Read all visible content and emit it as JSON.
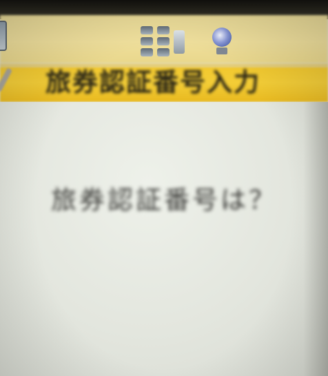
{
  "status_bar": {
    "icons": [
      "battery-icon",
      "grid-menu-icon",
      "globe-icon"
    ]
  },
  "header": {
    "title": "旅券認証番号入力",
    "back_icon": "back-icon"
  },
  "main": {
    "prompt": "旅券認証番号は？"
  },
  "colors": {
    "status_bar_bg": "#efdf9c",
    "title_bar_bg": "#f3cd37",
    "content_bg": "#e3e6df",
    "text": "#3b3b38"
  }
}
